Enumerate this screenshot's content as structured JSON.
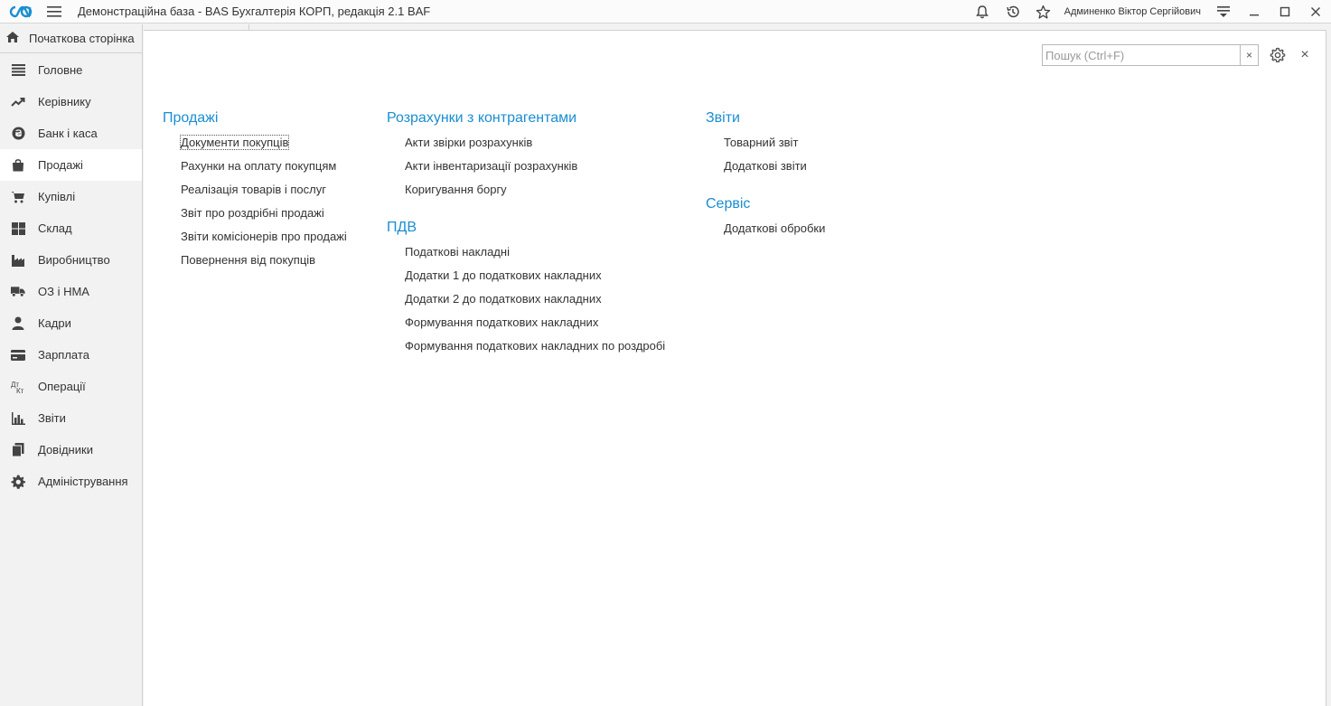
{
  "titlebar": {
    "title": "Демонстраційна база - BAS Бухгалтерія КОРП, редакція 2.1 BAF",
    "user": "Админенко Віктор Сергійович"
  },
  "sidebar": {
    "home_label": "Початкова сторінка",
    "items": [
      {
        "label": "Головне",
        "icon": "list-icon"
      },
      {
        "label": "Керівнику",
        "icon": "trend-icon"
      },
      {
        "label": "Банк і каса",
        "icon": "coin-icon"
      },
      {
        "label": "Продажі",
        "icon": "bag-icon",
        "active": true
      },
      {
        "label": "Купівлі",
        "icon": "cart-icon"
      },
      {
        "label": "Склад",
        "icon": "grid-icon"
      },
      {
        "label": "Виробництво",
        "icon": "factory-icon"
      },
      {
        "label": "ОЗ і НМА",
        "icon": "truck-icon"
      },
      {
        "label": "Кадри",
        "icon": "person-icon"
      },
      {
        "label": "Зарплата",
        "icon": "card-icon"
      },
      {
        "label": "Операції",
        "icon": "dt-kt-icon"
      },
      {
        "label": "Звіти",
        "icon": "bar-chart-icon"
      },
      {
        "label": "Довідники",
        "icon": "books-icon"
      },
      {
        "label": "Адміністрування",
        "icon": "gear-icon"
      }
    ]
  },
  "search": {
    "placeholder": "Пошук (Ctrl+F)",
    "value": "",
    "clear": "×"
  },
  "close_label": "×",
  "columns": [
    {
      "groups": [
        {
          "title": "Продажі",
          "links": [
            "Документи покупців",
            "Рахунки на оплату покупцям",
            "Реалізація товарів і послуг",
            "Звіт про роздрібні продажі",
            "Звіти комісіонерів про продажі",
            "Повернення від покупців"
          ]
        }
      ]
    },
    {
      "groups": [
        {
          "title": "Розрахунки з контрагентами",
          "links": [
            "Акти звірки розрахунків",
            "Акти інвентаризації розрахунків",
            "Коригування боргу"
          ]
        },
        {
          "title": "ПДВ",
          "links": [
            "Податкові накладні",
            "Додатки 1 до податкових накладних",
            "Додатки 2 до податкових накладних",
            "Формування податкових накладних",
            "Формування податкових накладних по роздробі"
          ]
        }
      ]
    },
    {
      "groups": [
        {
          "title": "Звіти",
          "links": [
            "Товарний звіт",
            "Додаткові звіти"
          ]
        },
        {
          "title": "Сервіс",
          "links": [
            "Додаткові обробки"
          ]
        }
      ]
    }
  ],
  "colors": {
    "accent": "#1a8ed1",
    "logo": "#1a8ed1"
  }
}
